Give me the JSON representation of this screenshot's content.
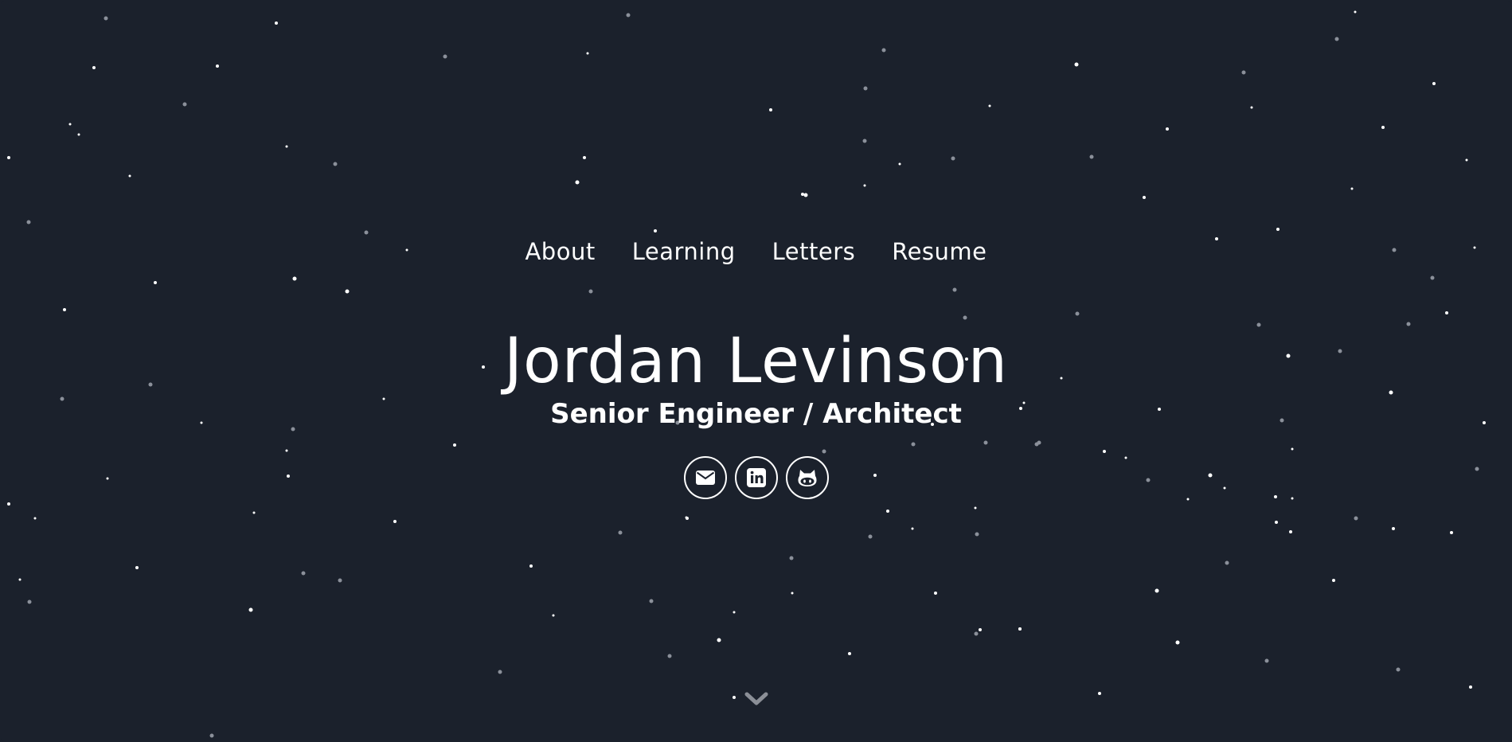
{
  "nav": {
    "items": [
      {
        "label": "About"
      },
      {
        "label": "Learning"
      },
      {
        "label": "Letters"
      },
      {
        "label": "Resume"
      }
    ]
  },
  "hero": {
    "name": "Jordan Levinson",
    "title": "Senior Engineer / Architect"
  },
  "social": {
    "icons": [
      "envelope-icon",
      "linkedin-icon",
      "github-icon"
    ]
  },
  "scroll": {
    "icon": "chevron-down-icon"
  },
  "colors": {
    "background": "#1b212c",
    "text": "#ffffff",
    "chevron": "#8b8f97"
  }
}
